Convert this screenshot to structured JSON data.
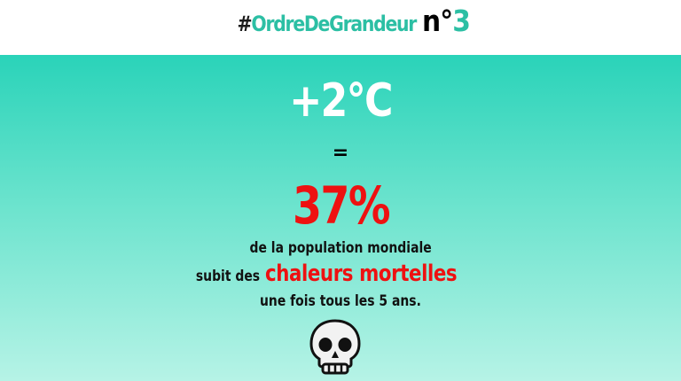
{
  "header": {
    "hash": "#",
    "hashtag": "OrdreDeGrandeur",
    "number_prefix": "n°",
    "number": "3"
  },
  "main": {
    "temperature": "+2°C",
    "equals": "=",
    "percentage": "37%",
    "line1": "de la population mondiale",
    "line2_prefix": "subit des",
    "line2_highlight": "chaleurs mortelles",
    "line3": "une fois tous les 5 ans.",
    "emoji": "skull-icon"
  },
  "colors": {
    "accent_teal": "#2cbfa4",
    "highlight_red": "#ee1111",
    "gradient_top": "#2ad3b9",
    "gradient_bottom": "#b6f3e6"
  }
}
